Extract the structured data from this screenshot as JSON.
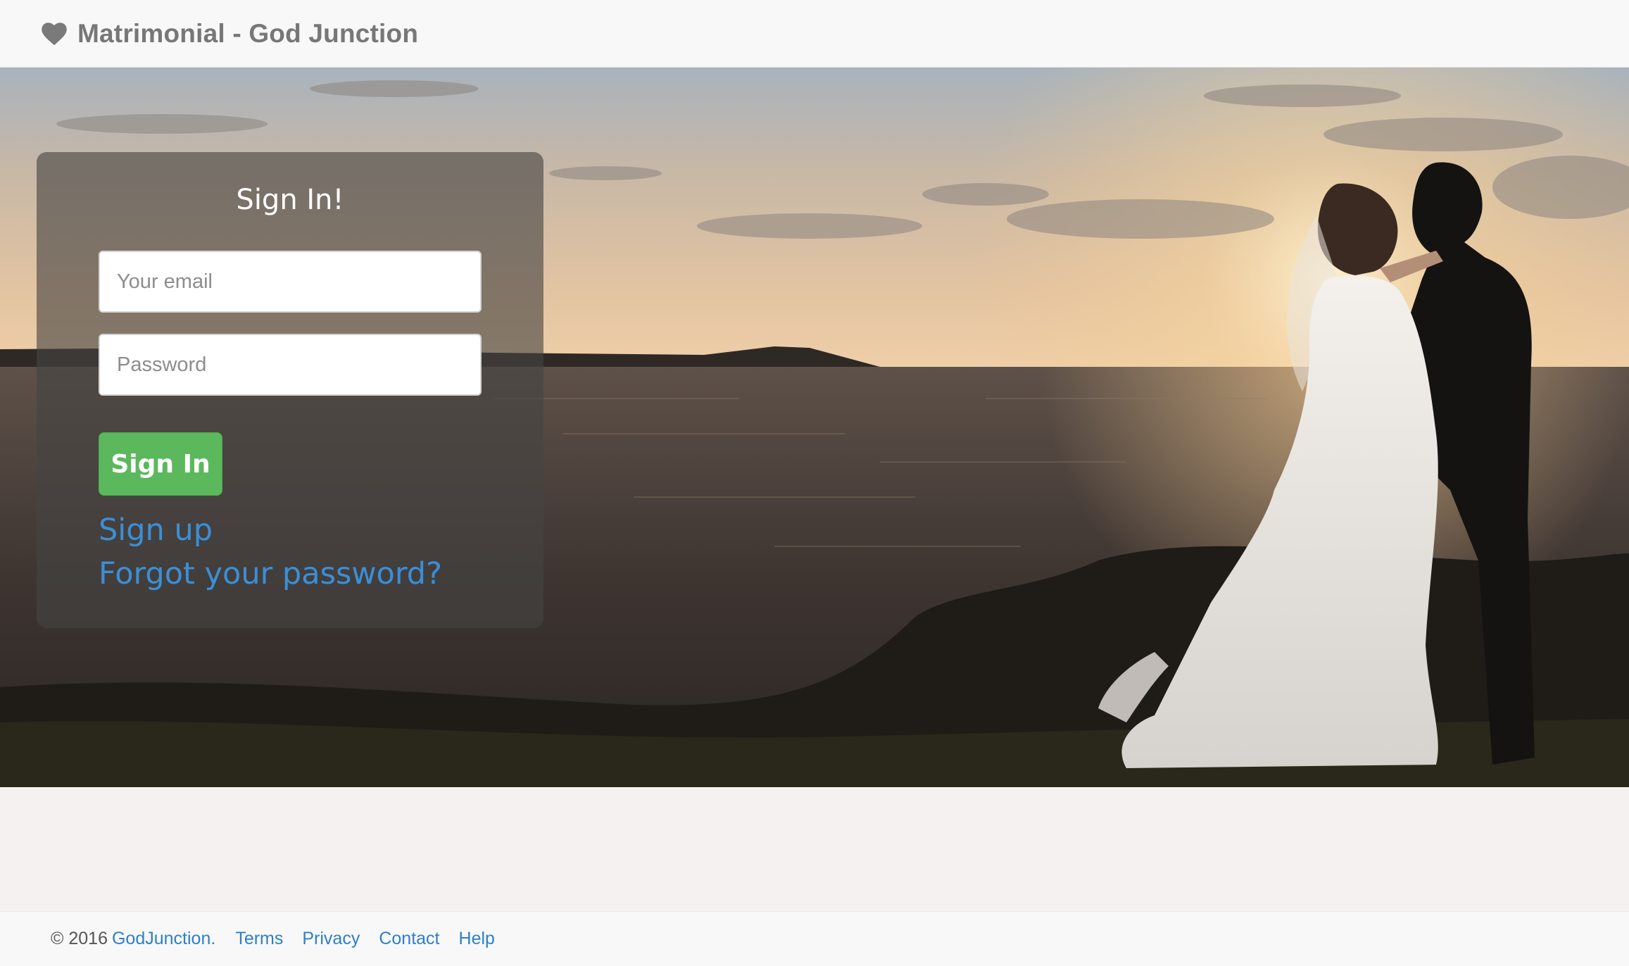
{
  "navbar": {
    "brand_icon": "heart-icon",
    "brand_text": "Matrimonial - God Junction"
  },
  "signin": {
    "title": "Sign In!",
    "email_placeholder": "Your email",
    "password_placeholder": "Password",
    "button_label": "Sign In",
    "signup_link": "Sign up",
    "forgot_link": "Forgot your password?"
  },
  "footer": {
    "copyright": "© 2016",
    "brand_link": "GodJunction",
    "dot": ".",
    "links": [
      "Terms",
      "Privacy",
      "Contact",
      "Help"
    ]
  },
  "colors": {
    "navbar_bg": "#f8f8f8",
    "brand_text": "#777777",
    "signin_button": "#5cb85c",
    "link_blue": "#3a8fd8",
    "page_bg": "#f4f1f0"
  }
}
